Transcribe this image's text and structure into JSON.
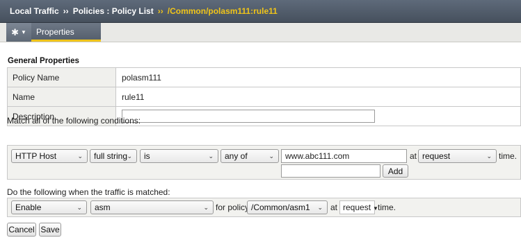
{
  "breadcrumb": {
    "items": [
      "Local Traffic",
      "Policies : Policy List"
    ],
    "separator": "››",
    "current": "/Common/polasm111:rule11"
  },
  "tabs": {
    "menu_icon": "gear-icon",
    "active": "Properties"
  },
  "general": {
    "title": "General Properties",
    "rows": [
      {
        "label": "Policy Name",
        "value": "polasm111"
      },
      {
        "label": "Name",
        "value": "rule11"
      },
      {
        "label": "Description",
        "value": ""
      }
    ]
  },
  "conditions": {
    "title": "Match all of the following conditions:",
    "operand": "HTTP Host",
    "selector": "full string",
    "operator": "is",
    "quantifier": "any of",
    "value": "www.abc111.com",
    "at_label": "at",
    "event": "request",
    "time_label": "time.",
    "new_value": "",
    "add_label": "Add"
  },
  "actions": {
    "title": "Do the following when the traffic is matched:",
    "action": "Enable",
    "target": "asm",
    "for_policy_label": "for policy",
    "policy": "/Common/asm1",
    "at_label": "at",
    "event": "request",
    "time_label": "time."
  },
  "buttons": {
    "cancel": "Cancel",
    "save": "Save"
  },
  "colors": {
    "header_bg": "#4f5a67",
    "accent": "#f0c419"
  }
}
